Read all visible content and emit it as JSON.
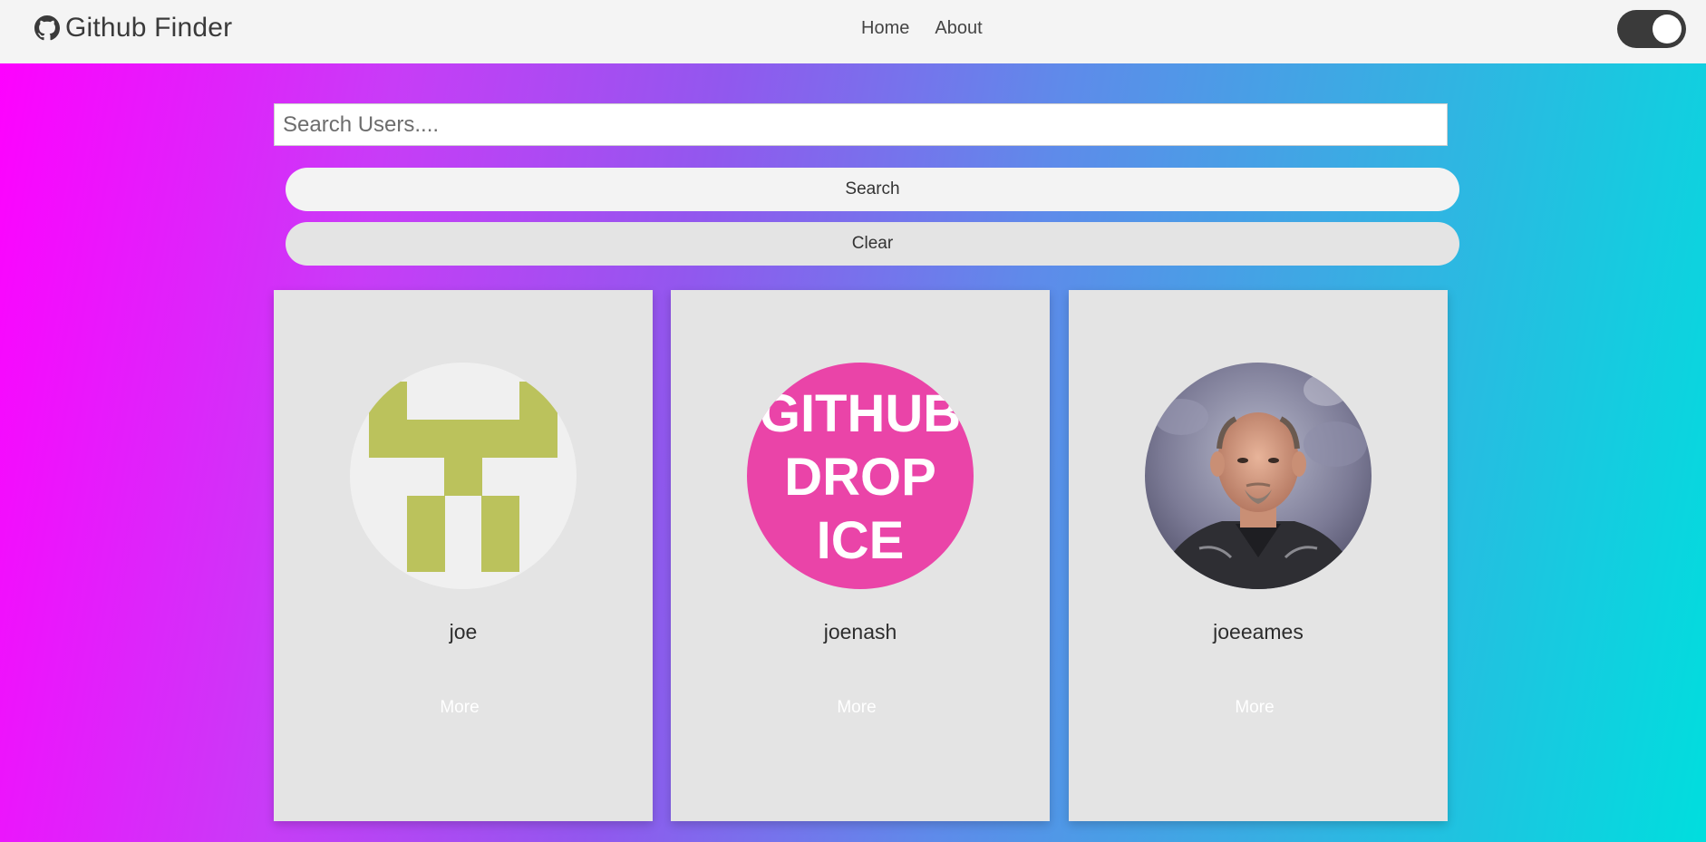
{
  "navbar": {
    "brand_title": "Github Finder",
    "brand_icon": "github-icon",
    "links": [
      {
        "label": "Home"
      },
      {
        "label": "About"
      }
    ],
    "theme_toggle": {
      "state": "on"
    }
  },
  "search": {
    "placeholder": "Search Users....",
    "value": "",
    "search_button_label": "Search",
    "clear_button_label": "Clear"
  },
  "users": [
    {
      "login": "joe",
      "more_label": "More",
      "avatar": "identicon-avatar"
    },
    {
      "login": "joenash",
      "more_label": "More",
      "avatar": "text-avatar",
      "avatar_text": [
        "GITHUB",
        "DROP",
        "ICE"
      ]
    },
    {
      "login": "joeeames",
      "more_label": "More",
      "avatar": "photo-avatar"
    }
  ],
  "colors": {
    "navbar_bg": "#f4f4f4",
    "gradient_start": "#ff00ff",
    "gradient_end": "#00dede",
    "card_bg": "#e4e4e4",
    "identicon_color": "#bbc25c",
    "text_avatar_bg": "#ea44a8",
    "toggle_bg": "#3a3a3a"
  }
}
